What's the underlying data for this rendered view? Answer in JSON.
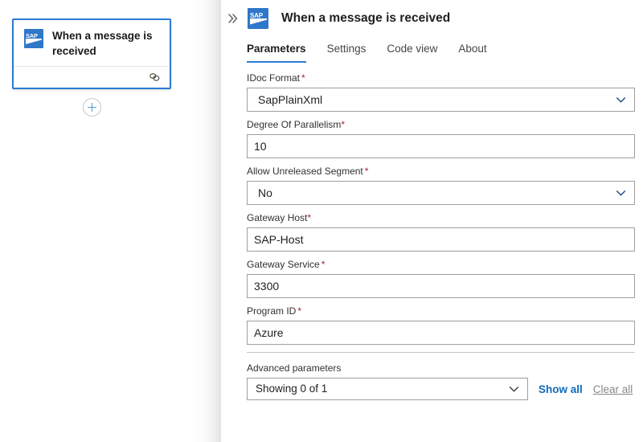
{
  "canvas": {
    "trigger_card": {
      "icon": "sap-logo-icon",
      "title": "When a message is received",
      "footer_icon": "link-icon"
    },
    "add_step_button": {
      "icon": "plus-icon",
      "label": "+"
    }
  },
  "panel": {
    "collapse_icon": "double-chevron-right-icon",
    "icon": "sap-logo-icon",
    "title": "When a message is received",
    "tabs": [
      {
        "label": "Parameters",
        "active": true
      },
      {
        "label": "Settings",
        "active": false
      },
      {
        "label": "Code view",
        "active": false
      },
      {
        "label": "About",
        "active": false
      }
    ],
    "fields": [
      {
        "label": "IDoc Format",
        "required_marker": "*",
        "type": "dropdown",
        "value": "SapPlainXml",
        "chevron_icon": "chevron-down-icon"
      },
      {
        "label": "Degree Of Parallelism",
        "required_marker": "*",
        "type": "textbox",
        "value": "10"
      },
      {
        "label": "Allow Unreleased Segment",
        "required_marker": "*",
        "type": "dropdown",
        "value": "No",
        "chevron_icon": "chevron-down-icon"
      },
      {
        "label": "Gateway Host",
        "required_marker": "*",
        "type": "textbox",
        "value": "SAP-Host"
      },
      {
        "label": "Gateway Service",
        "required_marker": "*",
        "type": "textbox",
        "value": "3300"
      },
      {
        "label": "Program ID",
        "required_marker": "*",
        "type": "textbox",
        "value": "Azure"
      }
    ],
    "advanced": {
      "label": "Advanced parameters",
      "dropdown_value": "Showing 0 of 1",
      "dropdown_chevron_icon": "chevron-down-icon",
      "show_all_label": "Show all",
      "clear_all_label": "Clear all"
    }
  },
  "colors": {
    "accent_blue": "#2b7cd3",
    "link_blue": "#0f6cbd",
    "required_red": "#a4262c",
    "sap_blue": "#2f77c9",
    "border_gray": "#a19f9d"
  }
}
